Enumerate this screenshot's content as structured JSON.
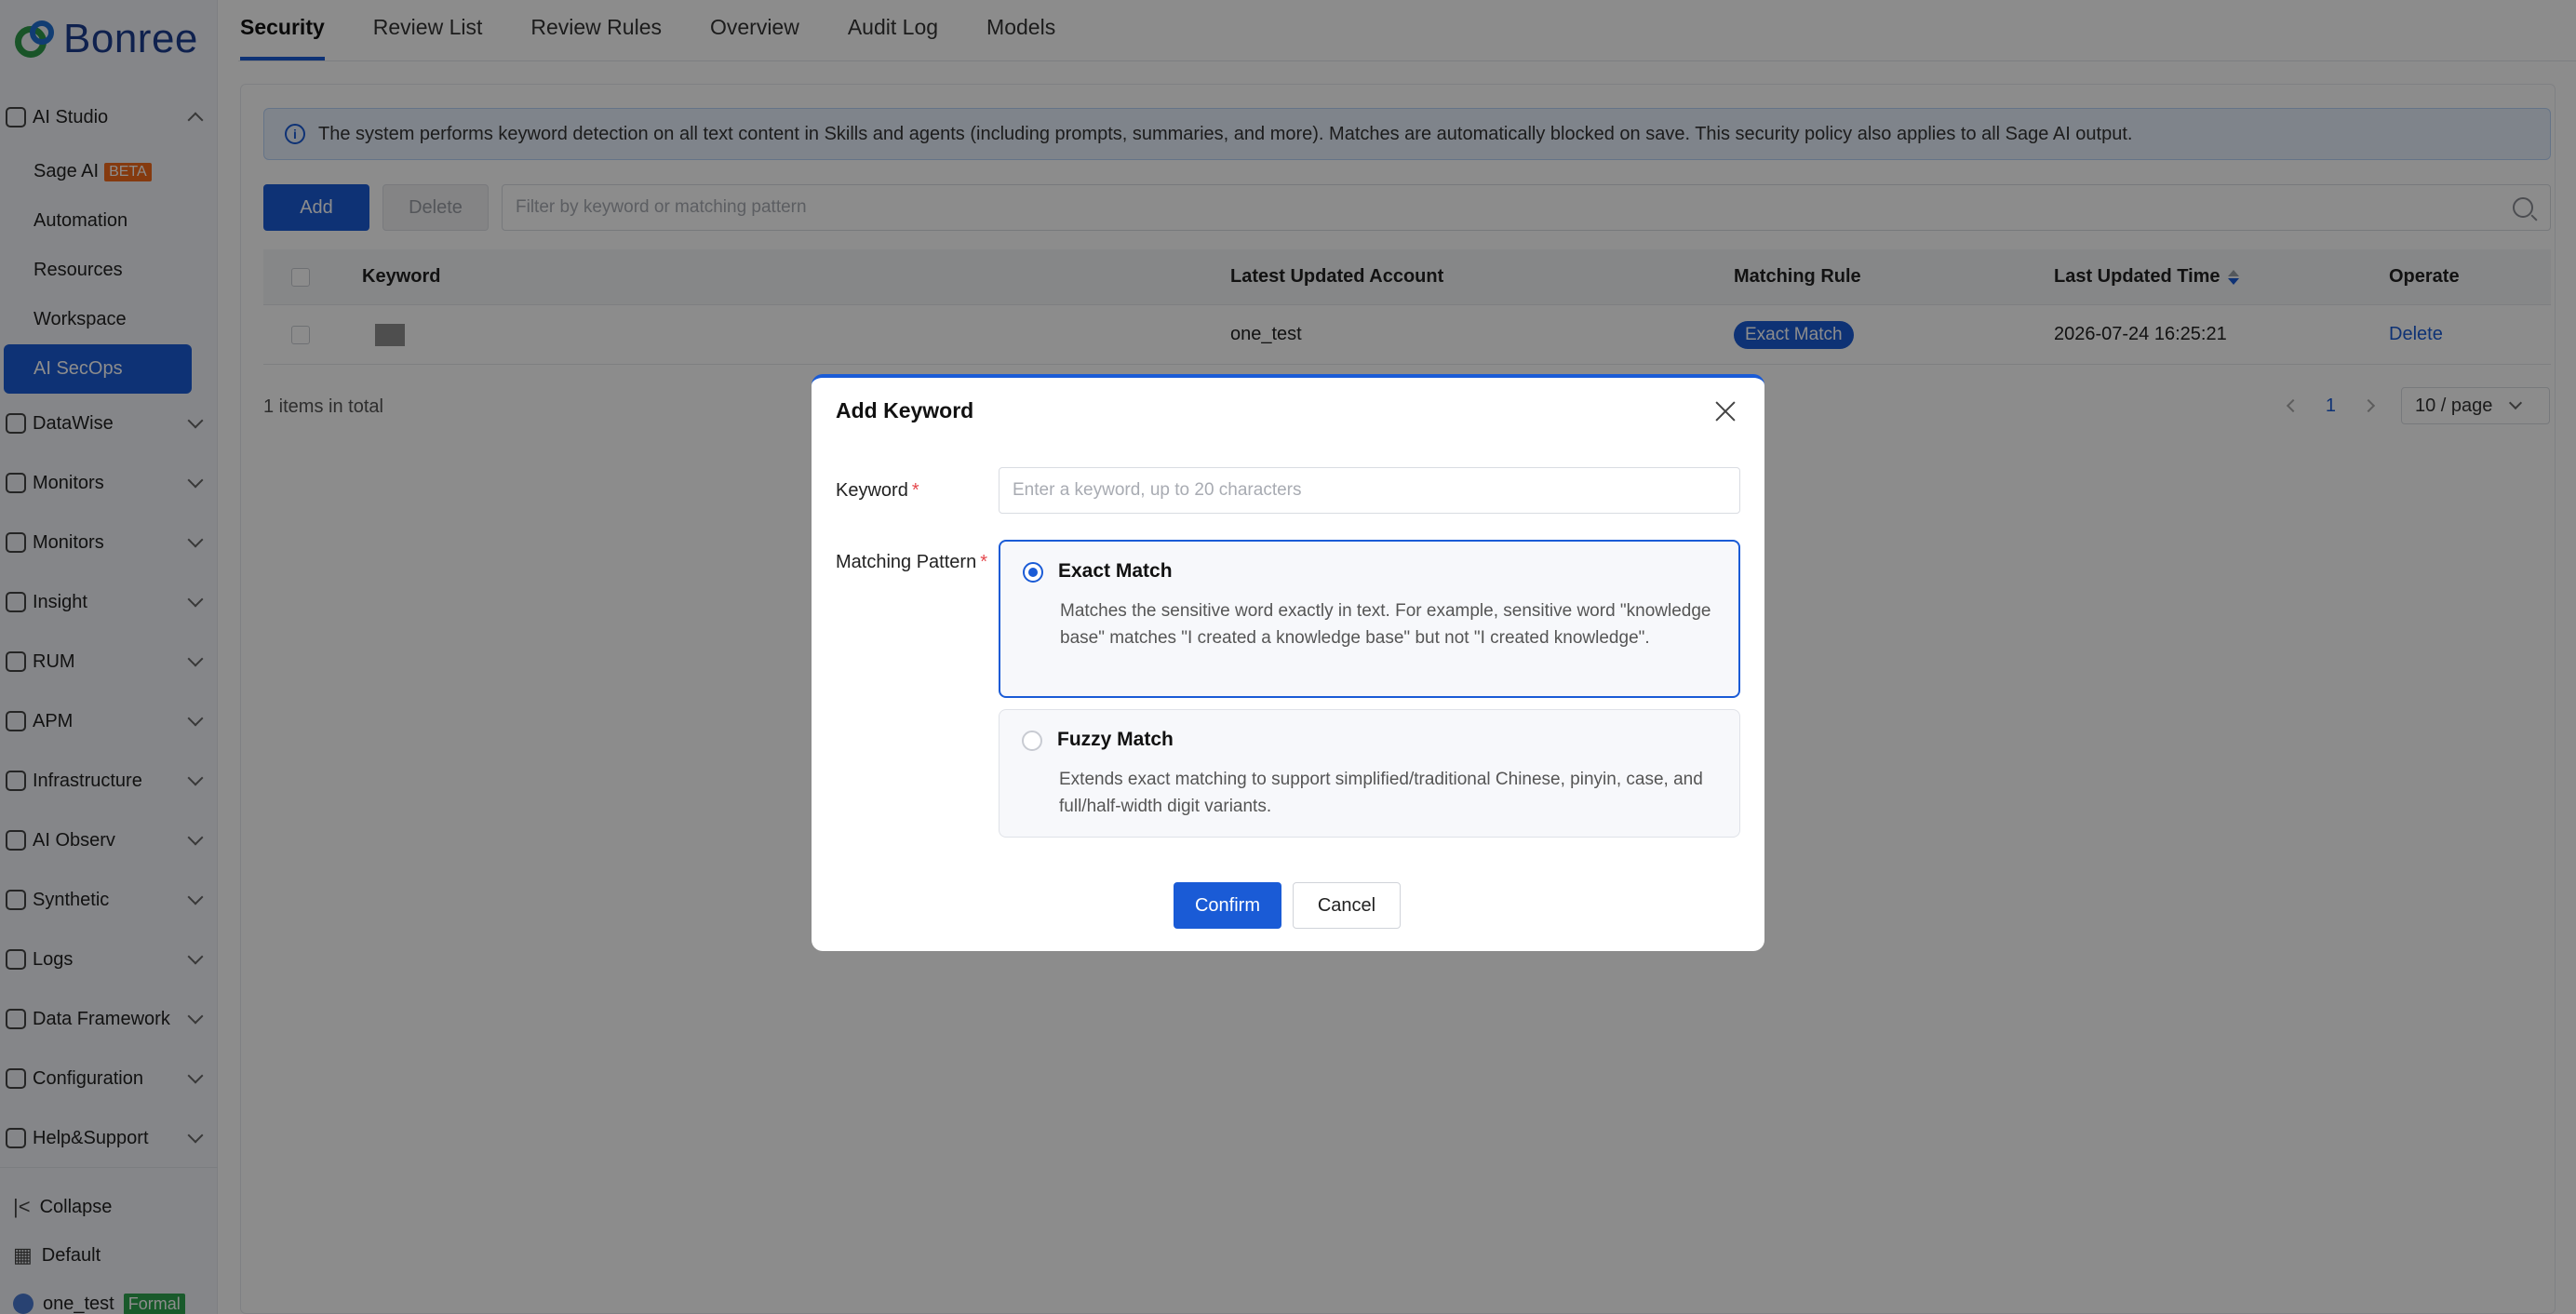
{
  "brand": {
    "name": "Bonree"
  },
  "sidebar": {
    "groups": [
      {
        "label": "AI Studio",
        "icon": "ai-studio-icon",
        "expanded": true
      },
      {
        "label": "DataWise",
        "icon": "datawise-icon"
      },
      {
        "label": "Monitors",
        "icon": "monitors-icon"
      },
      {
        "label": "Monitors",
        "icon": "monitors-icon"
      },
      {
        "label": "Insight",
        "icon": "insight-icon"
      },
      {
        "label": "RUM",
        "icon": "rum-icon"
      },
      {
        "label": "APM",
        "icon": "apm-icon"
      },
      {
        "label": "Infrastructure",
        "icon": "infrastructure-icon"
      },
      {
        "label": "AI Observ",
        "icon": "ai-observ-icon"
      },
      {
        "label": "Synthetic",
        "icon": "synthetic-icon"
      },
      {
        "label": "Logs",
        "icon": "logs-icon"
      },
      {
        "label": "Data Framework",
        "icon": "data-framework-icon"
      },
      {
        "label": "Configuration",
        "icon": "configuration-icon"
      },
      {
        "label": "Help&Support",
        "icon": "help-icon"
      }
    ],
    "ai_studio_items": [
      {
        "label": "Sage AI",
        "badge": "BETA"
      },
      {
        "label": "Automation"
      },
      {
        "label": "Resources"
      },
      {
        "label": "Workspace"
      },
      {
        "label": "AI SecOps",
        "active": true
      }
    ],
    "bottom": {
      "collapse": "Collapse",
      "default": "Default",
      "user": "one_test",
      "user_badge": "Formal"
    }
  },
  "tabs": [
    {
      "label": "Security",
      "active": true
    },
    {
      "label": "Review List"
    },
    {
      "label": "Review Rules"
    },
    {
      "label": "Overview"
    },
    {
      "label": "Audit Log"
    },
    {
      "label": "Models"
    }
  ],
  "notice": "The system performs keyword detection on all text content in Skills and agents (including prompts, summaries, and more). Matches are automatically blocked on save. This security policy also applies to all Sage AI output.",
  "toolbar": {
    "add_label": "Add",
    "delete_label": "Delete",
    "filter_placeholder": "Filter by keyword or matching pattern"
  },
  "table": {
    "columns": [
      "Keyword",
      "Latest Updated Account",
      "Matching Rule",
      "Last Updated Time",
      "Operate"
    ],
    "rows": [
      {
        "keyword": "",
        "account": "one_test",
        "rule": "Exact Match",
        "time": "2026-07-24 16:25:21",
        "operate": "Delete"
      }
    ]
  },
  "pagination": {
    "total": "1 items in total",
    "current": "1",
    "page_size": "10 / page"
  },
  "modal": {
    "title": "Add Keyword",
    "keyword_label": "Keyword",
    "keyword_placeholder": "Enter a keyword, up to 20 characters",
    "pattern_label": "Matching Pattern",
    "required_mark": "*",
    "options": [
      {
        "title": "Exact Match",
        "desc": "Matches the sensitive word exactly in text. For example, sensitive word \"knowledge base\" matches \"I created a knowledge base\" but not \"I created knowledge\".",
        "selected": true
      },
      {
        "title": "Fuzzy Match",
        "desc": "Extends exact matching to support simplified/traditional Chinese, pinyin, case, and full/half-width digit variants.",
        "selected": false
      }
    ],
    "confirm_label": "Confirm",
    "cancel_label": "Cancel"
  },
  "colors": {
    "accent": "#1a5bd6",
    "beta_badge": "#f26b1d",
    "formal_badge": "#2ea44f",
    "required": "#e5484d"
  }
}
